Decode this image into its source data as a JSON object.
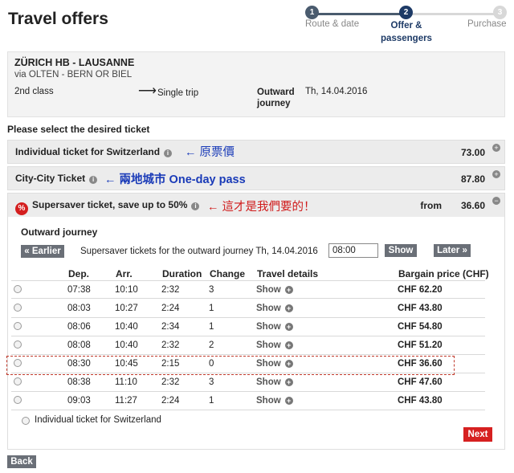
{
  "page_title": "Travel offers",
  "stepper": {
    "steps": [
      {
        "num": "1",
        "label": "Route & date"
      },
      {
        "num": "2",
        "label": "Offer & passengers"
      },
      {
        "num": "3",
        "label": "Purchase"
      }
    ]
  },
  "journey": {
    "route": "ZÜRICH HB - LAUSANNE",
    "via": "via OLTEN - BERN OR BIEL",
    "travel_class": "2nd class",
    "arrow": "⟶",
    "trip_type": "Single trip",
    "outward_label": "Outward journey",
    "outward_date": "Th, 14.04.2016"
  },
  "select_heading": "Please select the desired ticket",
  "tickets": [
    {
      "name": "Individual ticket for Switzerland",
      "price": "73.00",
      "note": "← 原票價"
    },
    {
      "name": "City-City Ticket",
      "price": "87.80",
      "note": "← 兩地城市 One-day pass"
    },
    {
      "name": "Supersaver ticket, save up to 50%",
      "from": "from",
      "price": "36.60",
      "note": "← 這才是我們要的！"
    }
  ],
  "icons": {
    "info": "i",
    "expand": "+",
    "collapse": "−",
    "percent": "%"
  },
  "panel": {
    "heading": "Outward journey",
    "earlier": "« Earlier",
    "description": "Supersaver tickets for the outward journey Th, 14.04.2016",
    "time_value": "08:00",
    "show_btn": "Show",
    "later": "Later »"
  },
  "table": {
    "headers": [
      "Dep.",
      "Arr.",
      "Duration",
      "Change",
      "Travel details",
      "Bargain price (CHF)"
    ],
    "show_label": "Show",
    "rows": [
      {
        "dep": "07:38",
        "arr": "10:10",
        "duration": "2:32",
        "change": "3",
        "price": "CHF 62.20"
      },
      {
        "dep": "08:03",
        "arr": "10:27",
        "duration": "2:24",
        "change": "1",
        "price": "CHF 43.80"
      },
      {
        "dep": "08:06",
        "arr": "10:40",
        "duration": "2:34",
        "change": "1",
        "price": "CHF 54.80"
      },
      {
        "dep": "08:08",
        "arr": "10:40",
        "duration": "2:32",
        "change": "2",
        "price": "CHF 51.20"
      },
      {
        "dep": "08:30",
        "arr": "10:45",
        "duration": "2:15",
        "change": "0",
        "price": "CHF 36.60"
      },
      {
        "dep": "08:38",
        "arr": "11:10",
        "duration": "2:32",
        "change": "3",
        "price": "CHF 47.60"
      },
      {
        "dep": "09:03",
        "arr": "11:27",
        "duration": "2:24",
        "change": "1",
        "price": "CHF 43.80"
      }
    ]
  },
  "individual_option": "Individual ticket for Switzerland",
  "next_label": "Next",
  "back_label": "Back",
  "colors": {
    "primary": "#1d3a66",
    "accent_red": "#d62020",
    "note_blue": "#1a3bb8",
    "button_grey": "#6a6f77"
  }
}
